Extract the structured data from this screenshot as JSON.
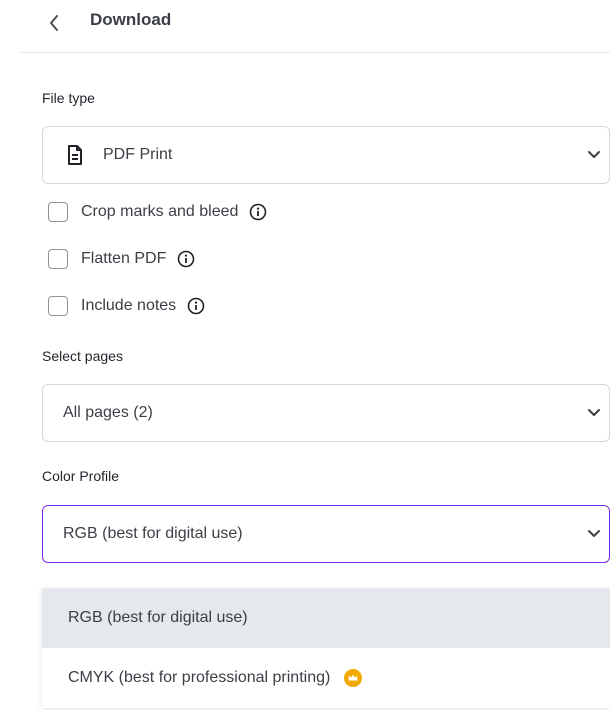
{
  "header": {
    "title": "Download"
  },
  "file_type": {
    "label": "File type",
    "selected": "PDF Print",
    "icon": "document-icon"
  },
  "options": [
    {
      "label": "Crop marks and bleed",
      "checked": false
    },
    {
      "label": "Flatten PDF",
      "checked": false
    },
    {
      "label": "Include notes",
      "checked": false
    }
  ],
  "select_pages": {
    "label": "Select pages",
    "selected": "All pages (2)"
  },
  "color_profile": {
    "label": "Color Profile",
    "selected": "RGB (best for digital use)",
    "dropdown": [
      {
        "label": "RGB (best for digital use)",
        "selected": true
      },
      {
        "label": "CMYK (best for professional printing)",
        "premium": true
      }
    ]
  },
  "colors": {
    "accent_border": "#7d2ae8",
    "premium_badge": "#f2a900",
    "selected_bg": "#e5e8ec"
  }
}
